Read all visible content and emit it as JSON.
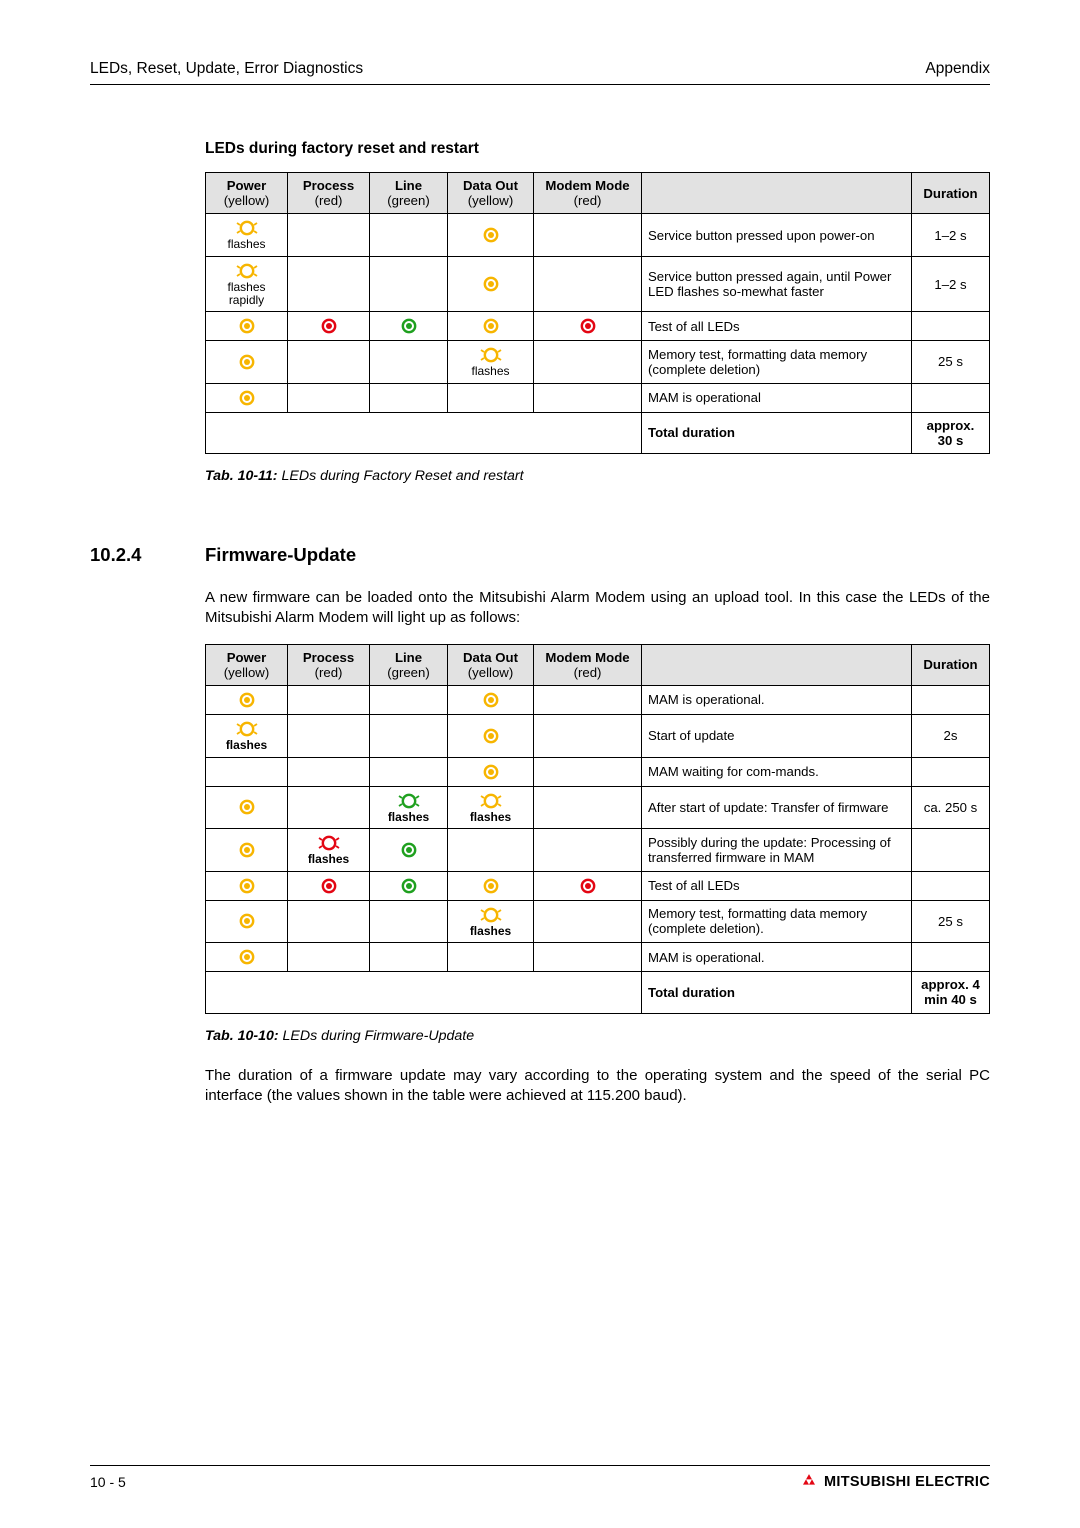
{
  "header": {
    "left": "LEDs, Reset, Update, Error Diagnostics",
    "right": "Appendix"
  },
  "section1": {
    "title": "LEDs during factory reset and restart",
    "columns": {
      "power": {
        "label": "Power",
        "sub": "(yellow)"
      },
      "process": {
        "label": "Process",
        "sub": "(red)"
      },
      "line": {
        "label": "Line",
        "sub": "(green)"
      },
      "data": {
        "label": "Data Out",
        "sub": "(yellow)"
      },
      "mode": {
        "label": "Modem Mode",
        "sub": "(red)"
      },
      "duration": "Duration"
    },
    "rows": [
      {
        "power": {
          "t": "flash",
          "c": "#f7b500"
        },
        "power_txt": "flashes",
        "data": {
          "t": "solid",
          "c": "#f7b500"
        },
        "desc": "Service button pressed upon power-on",
        "dur": "1–2 s"
      },
      {
        "power": {
          "t": "flash",
          "c": "#f7b500"
        },
        "power_txt": "flashes rapidly",
        "data": {
          "t": "solid",
          "c": "#f7b500"
        },
        "desc": "Service button pressed again, until Power LED flashes so-mewhat faster",
        "dur": "1–2 s"
      },
      {
        "power": {
          "t": "solid",
          "c": "#f7b500"
        },
        "process": {
          "t": "solid",
          "c": "#e30613"
        },
        "line": {
          "t": "solid",
          "c": "#1fa01f"
        },
        "data": {
          "t": "solid",
          "c": "#f7b500"
        },
        "mode": {
          "t": "solid",
          "c": "#e30613"
        },
        "desc": "Test of all LEDs",
        "dur": ""
      },
      {
        "power": {
          "t": "solid",
          "c": "#f7b500"
        },
        "data": {
          "t": "flash",
          "c": "#f7b500"
        },
        "data_txt": "flashes",
        "desc": "Memory test, formatting data memory (complete deletion)",
        "dur": "25 s"
      },
      {
        "power": {
          "t": "solid",
          "c": "#f7b500"
        },
        "desc": "MAM is operational",
        "dur": ""
      }
    ],
    "total_label": "Total duration",
    "total_dur": "approx. 30 s",
    "caption_bold": "Tab. 10-11:",
    "caption_rest": "LEDs during Factory Reset and restart"
  },
  "h2": {
    "num": "10.2.4",
    "title": "Firmware-Update"
  },
  "para1": "A new firmware can be loaded onto the Mitsubishi Alarm Modem using an upload tool. In this case the LEDs of the Mitsubishi Alarm Modem will light up as follows:",
  "section2": {
    "columns": {
      "power": {
        "label": "Power",
        "sub": "(yellow)"
      },
      "process": {
        "label": "Process",
        "sub": "(red)"
      },
      "line": {
        "label": "Line",
        "sub": "(green)"
      },
      "data": {
        "label": "Data Out",
        "sub": "(yellow)"
      },
      "mode": {
        "label": "Modem Mode",
        "sub": "(red)"
      },
      "duration": "Duration"
    },
    "rows": [
      {
        "power": {
          "t": "solid",
          "c": "#f7b500"
        },
        "data": {
          "t": "solid",
          "c": "#f7b500"
        },
        "desc": "MAM is operational.",
        "dur": ""
      },
      {
        "power": {
          "t": "flash",
          "c": "#f7b500"
        },
        "power_txt": "flashes",
        "data": {
          "t": "solid",
          "c": "#f7b500"
        },
        "desc": "Start of update",
        "dur": "2s"
      },
      {
        "data": {
          "t": "solid",
          "c": "#f7b500"
        },
        "desc": "MAM waiting for com-mands.",
        "dur": ""
      },
      {
        "power": {
          "t": "solid",
          "c": "#f7b500"
        },
        "line": {
          "t": "flash",
          "c": "#1fa01f"
        },
        "line_txt": "flashes",
        "data": {
          "t": "flash",
          "c": "#f7b500"
        },
        "data_txt": "flashes",
        "desc": "After start of update: Transfer of firmware",
        "dur": "ca. 250 s"
      },
      {
        "power": {
          "t": "solid",
          "c": "#f7b500"
        },
        "process": {
          "t": "flash",
          "c": "#e30613"
        },
        "process_txt": "flashes",
        "line": {
          "t": "solid",
          "c": "#1fa01f"
        },
        "desc": "Possibly during the update: Processing of transferred firmware in MAM",
        "dur": ""
      },
      {
        "power": {
          "t": "solid",
          "c": "#f7b500"
        },
        "process": {
          "t": "solid",
          "c": "#e30613"
        },
        "line": {
          "t": "solid",
          "c": "#1fa01f"
        },
        "data": {
          "t": "solid",
          "c": "#f7b500"
        },
        "mode": {
          "t": "solid",
          "c": "#e30613"
        },
        "desc": "Test of all LEDs",
        "dur": ""
      },
      {
        "power": {
          "t": "solid",
          "c": "#f7b500"
        },
        "data": {
          "t": "flash",
          "c": "#f7b500"
        },
        "data_txt": "flashes",
        "desc": "Memory test, formatting data memory (complete deletion).",
        "dur": "25 s"
      },
      {
        "power": {
          "t": "solid",
          "c": "#f7b500"
        },
        "desc": "MAM is operational.",
        "dur": ""
      }
    ],
    "total_label": "Total duration",
    "total_dur": "approx. 4 min 40 s",
    "caption_bold": "Tab. 10-10:",
    "caption_rest": " LEDs during Firmware-Update"
  },
  "para2": "The duration of a firmware update may vary according to the operating system and the speed of the serial PC interface (the values shown in the table were achieved at 115.200 baud).",
  "footer": {
    "page": "10 - 5",
    "brand": "MITSUBISHI ELECTRIC"
  }
}
